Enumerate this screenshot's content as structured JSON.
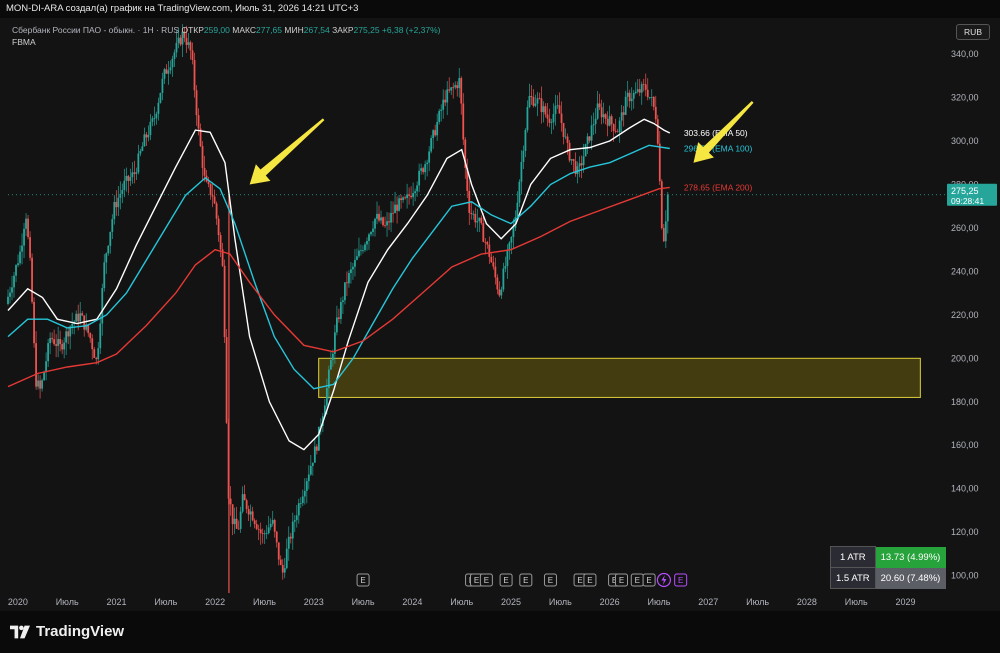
{
  "header": {
    "title": "MON-DI-ARA создал(а) график на TradingView.com, Июль 31, 2026 14:21 UTC+3"
  },
  "legend": {
    "symbol": "Сбербанк России ПАО - обыкн. · 1Н · RUS",
    "open_label": "ОТКР",
    "open_value": "259,00",
    "high_label": "МАКС",
    "high_value": "277,65",
    "low_label": "МИН",
    "low_value": "267,54",
    "close_label": "ЗАКР",
    "close_value": "275,25",
    "change": "+6,38 (+2,37%)",
    "indicator": "FBMA"
  },
  "currency_button": "RUB",
  "atr": {
    "row1_label": "1 ATR",
    "row1_value": "13.73 (4.99%)",
    "row2_label": "1.5 ATR",
    "row2_value": "20.60 (7.48%)"
  },
  "brand": "TradingView",
  "colors": {
    "up": "#26a69a",
    "down": "#ef5350",
    "ema50": "#ffffff",
    "ema100": "#26c6da",
    "ema200": "#e53935",
    "zone": "#6b5e10",
    "arrow": "#f5e642"
  },
  "chart_data": {
    "type": "line",
    "price_axis": {
      "ylim": [
        92,
        352
      ],
      "ticks": [
        100,
        120,
        140,
        160,
        180,
        200,
        220,
        240,
        260,
        280,
        300,
        320,
        340
      ],
      "tick_labels": [
        "100,00",
        "120,00",
        "140,00",
        "160,00",
        "180,00",
        "200,00",
        "220,00",
        "240,00",
        "260,00",
        "280,00",
        "300,00",
        "320,00",
        "340,00"
      ]
    },
    "time_axis": {
      "xlim": [
        2019.9,
        2029.4
      ],
      "ticks": [
        {
          "t": 2020.0,
          "label": "2020"
        },
        {
          "t": 2020.5,
          "label": "Июль"
        },
        {
          "t": 2021.0,
          "label": "2021"
        },
        {
          "t": 2021.5,
          "label": "Июль"
        },
        {
          "t": 2022.0,
          "label": "2022"
        },
        {
          "t": 2022.5,
          "label": "Июль"
        },
        {
          "t": 2023.0,
          "label": "2023"
        },
        {
          "t": 2023.5,
          "label": "Июль"
        },
        {
          "t": 2024.0,
          "label": "2024"
        },
        {
          "t": 2024.5,
          "label": "Июль"
        },
        {
          "t": 2025.0,
          "label": "2025"
        },
        {
          "t": 2025.5,
          "label": "Июль"
        },
        {
          "t": 2026.0,
          "label": "2026"
        },
        {
          "t": 2026.5,
          "label": "Июль"
        },
        {
          "t": 2027.0,
          "label": "2027"
        },
        {
          "t": 2027.5,
          "label": "Июль"
        },
        {
          "t": 2028.0,
          "label": "2028"
        },
        {
          "t": 2028.5,
          "label": "Июль"
        },
        {
          "t": 2029.0,
          "label": "2029"
        },
        {
          "t": 2029.5,
          "label": "Июль"
        }
      ]
    },
    "price_path": [
      [
        2019.9,
        225
      ],
      [
        2020.05,
        250
      ],
      [
        2020.1,
        268
      ],
      [
        2020.15,
        240
      ],
      [
        2020.2,
        190
      ],
      [
        2020.25,
        185
      ],
      [
        2020.35,
        210
      ],
      [
        2020.45,
        205
      ],
      [
        2020.55,
        215
      ],
      [
        2020.65,
        220
      ],
      [
        2020.75,
        210
      ],
      [
        2020.82,
        198
      ],
      [
        2020.9,
        245
      ],
      [
        2021.0,
        270
      ],
      [
        2021.1,
        280
      ],
      [
        2021.2,
        285
      ],
      [
        2021.3,
        300
      ],
      [
        2021.4,
        310
      ],
      [
        2021.5,
        330
      ],
      [
        2021.6,
        340
      ],
      [
        2021.7,
        350
      ],
      [
        2021.78,
        340
      ],
      [
        2021.85,
        305
      ],
      [
        2021.92,
        280
      ],
      [
        2022.0,
        275
      ],
      [
        2022.05,
        260
      ],
      [
        2022.1,
        240
      ],
      [
        2022.13,
        190
      ],
      [
        2022.15,
        140
      ],
      [
        2022.2,
        125
      ],
      [
        2022.25,
        120
      ],
      [
        2022.3,
        135
      ],
      [
        2022.4,
        128
      ],
      [
        2022.5,
        118
      ],
      [
        2022.6,
        125
      ],
      [
        2022.7,
        100
      ],
      [
        2022.75,
        112
      ],
      [
        2022.85,
        130
      ],
      [
        2022.95,
        145
      ],
      [
        2023.05,
        160
      ],
      [
        2023.15,
        185
      ],
      [
        2023.25,
        215
      ],
      [
        2023.35,
        235
      ],
      [
        2023.45,
        245
      ],
      [
        2023.55,
        255
      ],
      [
        2023.65,
        265
      ],
      [
        2023.75,
        260
      ],
      [
        2023.85,
        270
      ],
      [
        2023.95,
        272
      ],
      [
        2024.05,
        280
      ],
      [
        2024.15,
        290
      ],
      [
        2024.25,
        305
      ],
      [
        2024.35,
        320
      ],
      [
        2024.45,
        325
      ],
      [
        2024.5,
        328
      ],
      [
        2024.55,
        290
      ],
      [
        2024.6,
        268
      ],
      [
        2024.7,
        262
      ],
      [
        2024.8,
        248
      ],
      [
        2024.9,
        230
      ],
      [
        2024.95,
        240
      ],
      [
        2025.05,
        260
      ],
      [
        2025.15,
        300
      ],
      [
        2025.2,
        320
      ],
      [
        2025.3,
        318
      ],
      [
        2025.4,
        310
      ],
      [
        2025.5,
        315
      ],
      [
        2025.6,
        295
      ],
      [
        2025.7,
        285
      ],
      [
        2025.8,
        300
      ],
      [
        2025.9,
        315
      ],
      [
        2026.0,
        310
      ],
      [
        2026.1,
        305
      ],
      [
        2026.2,
        320
      ],
      [
        2026.3,
        322
      ],
      [
        2026.38,
        325
      ],
      [
        2026.45,
        318
      ],
      [
        2026.5,
        310
      ],
      [
        2026.53,
        280
      ],
      [
        2026.56,
        252
      ],
      [
        2026.58,
        260
      ],
      [
        2026.61,
        275.25
      ]
    ],
    "series": [
      {
        "name": "EMA 50",
        "last_label": "303.66 (EMA 50)",
        "values": [
          [
            2019.9,
            222
          ],
          [
            2020.1,
            232
          ],
          [
            2020.25,
            228
          ],
          [
            2020.4,
            218
          ],
          [
            2020.6,
            216
          ],
          [
            2020.8,
            218
          ],
          [
            2021.0,
            232
          ],
          [
            2021.2,
            252
          ],
          [
            2021.4,
            270
          ],
          [
            2021.6,
            288
          ],
          [
            2021.8,
            305
          ],
          [
            2021.95,
            304
          ],
          [
            2022.1,
            290
          ],
          [
            2022.2,
            255
          ],
          [
            2022.35,
            210
          ],
          [
            2022.55,
            180
          ],
          [
            2022.75,
            162
          ],
          [
            2022.9,
            158
          ],
          [
            2023.05,
            165
          ],
          [
            2023.2,
            185
          ],
          [
            2023.35,
            208
          ],
          [
            2023.55,
            235
          ],
          [
            2023.75,
            250
          ],
          [
            2023.95,
            262
          ],
          [
            2024.15,
            275
          ],
          [
            2024.35,
            292
          ],
          [
            2024.5,
            296
          ],
          [
            2024.6,
            280
          ],
          [
            2024.75,
            262
          ],
          [
            2024.9,
            255
          ],
          [
            2025.05,
            262
          ],
          [
            2025.2,
            280
          ],
          [
            2025.4,
            292
          ],
          [
            2025.6,
            296
          ],
          [
            2025.8,
            297
          ],
          [
            2026.0,
            300
          ],
          [
            2026.2,
            306
          ],
          [
            2026.35,
            310
          ],
          [
            2026.45,
            308
          ],
          [
            2026.55,
            305
          ],
          [
            2026.61,
            303.66
          ]
        ]
      },
      {
        "name": "EMA 100",
        "last_label": "296.54 (EMA 100)",
        "values": [
          [
            2019.9,
            210
          ],
          [
            2020.1,
            218
          ],
          [
            2020.3,
            218
          ],
          [
            2020.5,
            214
          ],
          [
            2020.7,
            215
          ],
          [
            2020.9,
            220
          ],
          [
            2021.1,
            230
          ],
          [
            2021.3,
            245
          ],
          [
            2021.5,
            260
          ],
          [
            2021.7,
            275
          ],
          [
            2021.9,
            283
          ],
          [
            2022.05,
            278
          ],
          [
            2022.2,
            262
          ],
          [
            2022.4,
            235
          ],
          [
            2022.6,
            210
          ],
          [
            2022.8,
            195
          ],
          [
            2023.0,
            186
          ],
          [
            2023.2,
            188
          ],
          [
            2023.4,
            200
          ],
          [
            2023.6,
            216
          ],
          [
            2023.8,
            232
          ],
          [
            2024.0,
            246
          ],
          [
            2024.2,
            258
          ],
          [
            2024.4,
            270
          ],
          [
            2024.6,
            272
          ],
          [
            2024.8,
            266
          ],
          [
            2025.0,
            262
          ],
          [
            2025.2,
            270
          ],
          [
            2025.4,
            280
          ],
          [
            2025.6,
            285
          ],
          [
            2025.8,
            288
          ],
          [
            2026.0,
            290
          ],
          [
            2026.2,
            294
          ],
          [
            2026.4,
            298
          ],
          [
            2026.61,
            296.54
          ]
        ]
      },
      {
        "name": "EMA 200",
        "last_label": "278.65 (EMA 200)",
        "values": [
          [
            2019.9,
            187
          ],
          [
            2020.2,
            193
          ],
          [
            2020.5,
            196
          ],
          [
            2020.8,
            198
          ],
          [
            2021.0,
            202
          ],
          [
            2021.3,
            215
          ],
          [
            2021.6,
            230
          ],
          [
            2021.8,
            243
          ],
          [
            2022.0,
            250
          ],
          [
            2022.15,
            248
          ],
          [
            2022.35,
            235
          ],
          [
            2022.6,
            220
          ],
          [
            2022.9,
            206
          ],
          [
            2023.2,
            203
          ],
          [
            2023.5,
            208
          ],
          [
            2023.8,
            218
          ],
          [
            2024.1,
            230
          ],
          [
            2024.4,
            242
          ],
          [
            2024.7,
            248
          ],
          [
            2025.0,
            250
          ],
          [
            2025.3,
            256
          ],
          [
            2025.6,
            263
          ],
          [
            2025.9,
            268
          ],
          [
            2026.2,
            273
          ],
          [
            2026.5,
            278
          ],
          [
            2026.61,
            278.65
          ]
        ]
      }
    ],
    "current_price_label": "275,25",
    "countdown_label": "09:28:41",
    "zone": {
      "t0": 2023.05,
      "t1": 2029.15,
      "p0": 182,
      "p1": 200
    },
    "earnings_markers": [
      2023.5,
      2024.6,
      2024.65,
      2024.75,
      2024.95,
      2025.15,
      2025.4,
      2025.7,
      2025.8,
      2026.05,
      2026.12,
      2026.28,
      2026.4
    ],
    "earnings_label": "E",
    "arrows": [
      {
        "from_t": 2023.1,
        "from_p": 310,
        "to_t": 2022.35,
        "to_p": 280
      },
      {
        "from_t": 2027.45,
        "from_p": 318,
        "to_t": 2026.85,
        "to_p": 290
      }
    ]
  }
}
